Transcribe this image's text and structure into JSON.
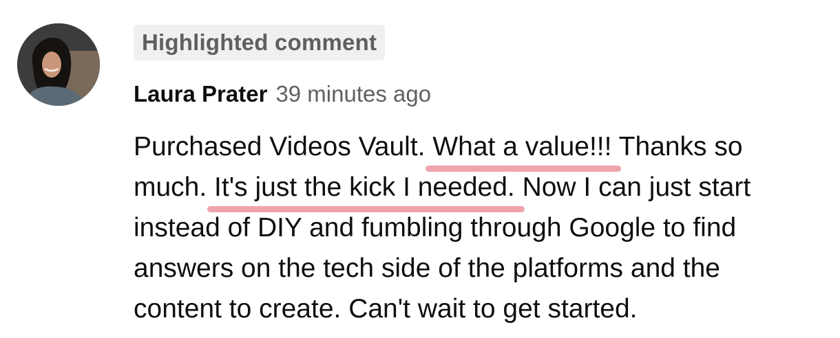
{
  "badge": {
    "label": "Highlighted comment"
  },
  "comment": {
    "author": "Laura Prater",
    "timestamp": "39 minutes ago",
    "line1": {
      "before": "Purchased Videos Vault. ",
      "highlight": "What a value!!!",
      "after": " Thanks so"
    },
    "line2": {
      "before": "much. ",
      "highlight": "It's just the kick I needed.",
      "after": " Now I can just start"
    },
    "line3": "instead of DIY and fumbling through Google to find",
    "line4": "answers on the tech side of the platforms and the",
    "line5": "content to create. Can't wait to get started."
  },
  "colors": {
    "highlight_underline": "#eea4ad",
    "badge_background": "#f0f0f0",
    "badge_text": "#5f5f5f",
    "timestamp_text": "#606060"
  }
}
